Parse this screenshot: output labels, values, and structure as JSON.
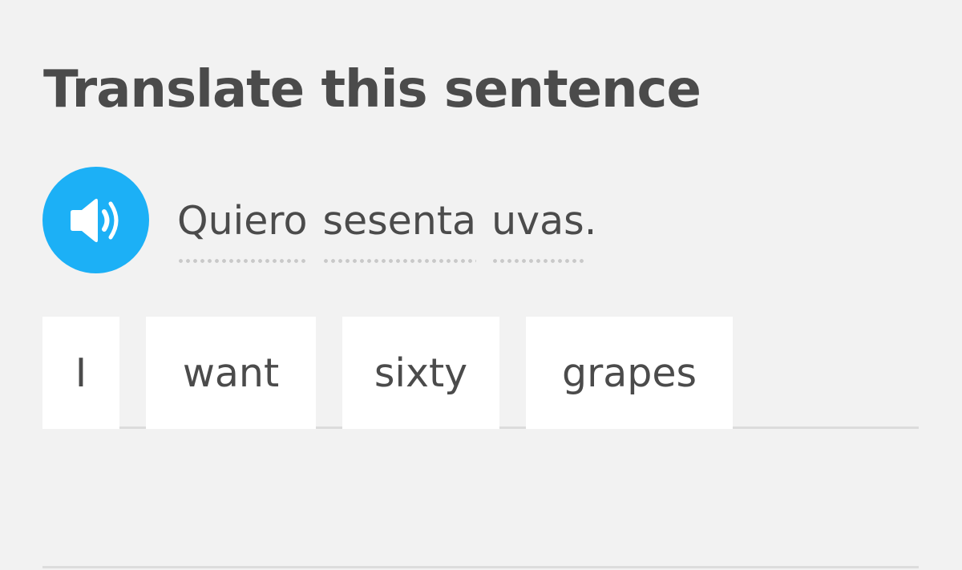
{
  "instruction": "Translate this sentence",
  "prompt": {
    "words": [
      "Quiero",
      "sesenta",
      "uvas."
    ]
  },
  "answer": {
    "tiles": [
      "I",
      "want",
      "sixty",
      "grapes"
    ]
  },
  "colors": {
    "accent": "#1cb0f6",
    "background": "#f2f2f2",
    "text": "#4b4b4b",
    "tile": "#ffffff",
    "divider": "#dcdcdc"
  },
  "icons": {
    "speaker": "speaker-icon"
  }
}
